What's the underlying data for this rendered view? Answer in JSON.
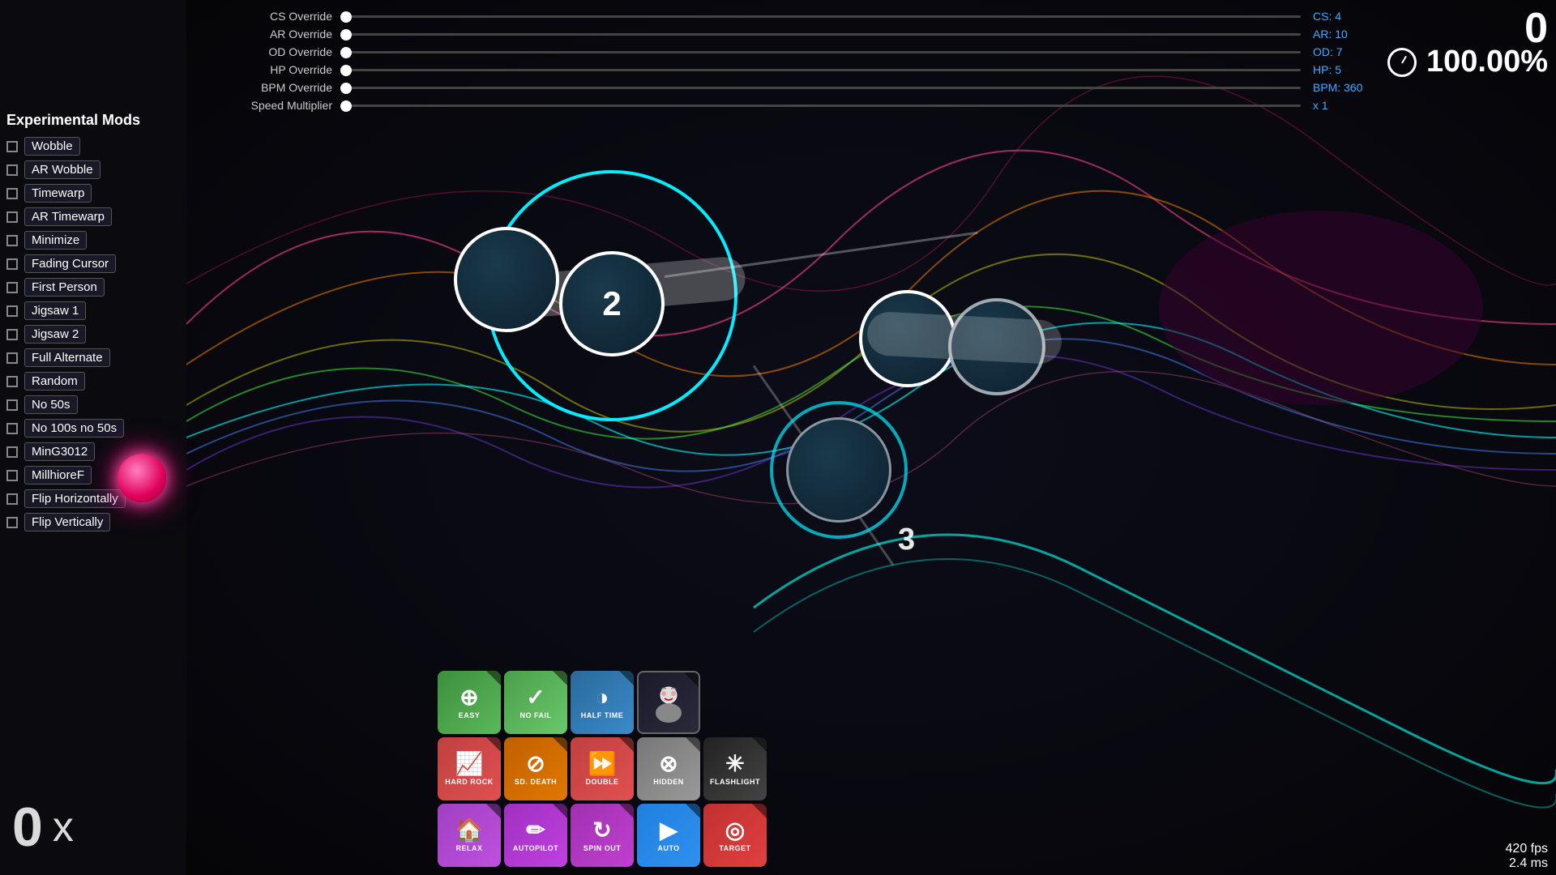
{
  "sliders": {
    "cs_override": {
      "label": "CS Override",
      "value": "CS: 4"
    },
    "ar_override": {
      "label": "AR Override",
      "value": "AR: 10"
    },
    "od_override": {
      "label": "OD Override",
      "value": "OD: 7"
    },
    "hp_override": {
      "label": "HP Override",
      "value": "HP: 5"
    },
    "bpm_override": {
      "label": "BPM Override",
      "value": "BPM: 360"
    },
    "speed_multiplier": {
      "label": "Speed Multiplier",
      "value": "x 1"
    }
  },
  "sidebar": {
    "title": "Experimental Mods",
    "mods": [
      {
        "label": "Wobble",
        "checked": false
      },
      {
        "label": "AR Wobble",
        "checked": false
      },
      {
        "label": "Timewarp",
        "checked": false
      },
      {
        "label": "AR Timewarp",
        "checked": false
      },
      {
        "label": "Minimize",
        "checked": false
      },
      {
        "label": "Fading Cursor",
        "checked": false
      },
      {
        "label": "First Person",
        "checked": false
      },
      {
        "label": "Jigsaw 1",
        "checked": false
      },
      {
        "label": "Jigsaw 2",
        "checked": false
      },
      {
        "label": "Full Alternate",
        "checked": false
      },
      {
        "label": "Random",
        "checked": false
      },
      {
        "label": "No 50s",
        "checked": false
      },
      {
        "label": "No 100s no 50s",
        "checked": false
      },
      {
        "label": "MinG3012",
        "checked": false
      },
      {
        "label": "MillhioreF",
        "checked": false
      },
      {
        "label": "Flip Horizontally",
        "checked": false
      },
      {
        "label": "Flip Vertically",
        "checked": false
      }
    ]
  },
  "score": {
    "main": "0",
    "accuracy": "100.00%"
  },
  "bottom_score": {
    "number": "0",
    "multiplier": "x"
  },
  "fps": "420 fps",
  "ms": "2.4 ms",
  "mod_buttons": [
    {
      "id": "easy",
      "label": "EASY",
      "icon": "⊕",
      "class": "btn-easy"
    },
    {
      "id": "nofail",
      "label": "NO FAIL",
      "icon": "✓",
      "class": "btn-nofail"
    },
    {
      "id": "halftime",
      "label": "HALF TIME",
      "icon": "◑",
      "class": "btn-halftime"
    },
    {
      "id": "hardrock",
      "label": "HARD ROCK",
      "icon": "📈",
      "class": "btn-hardrock"
    },
    {
      "id": "sddeath",
      "label": "SD. DEATH",
      "icon": "⊘",
      "class": "btn-sddeath"
    },
    {
      "id": "double",
      "label": "DOUBLE",
      "icon": "⏩",
      "class": "btn-double"
    },
    {
      "id": "hidden",
      "label": "HIDDEN",
      "icon": "⊗",
      "class": "btn-hidden"
    },
    {
      "id": "flashlight",
      "label": "FLASHLIGHT",
      "icon": "✳",
      "class": "btn-flashlight"
    },
    {
      "id": "relax",
      "label": "RELAX",
      "icon": "🏠",
      "class": "btn-relax"
    },
    {
      "id": "autopilot",
      "label": "AUTOPILOT",
      "icon": "✏",
      "class": "btn-autopilot"
    },
    {
      "id": "spinout",
      "label": "SPIN OUT",
      "icon": "↻",
      "class": "btn-spinout"
    },
    {
      "id": "auto",
      "label": "AUTO",
      "icon": "▶",
      "class": "btn-auto"
    },
    {
      "id": "target",
      "label": "TARGET",
      "icon": "◎",
      "class": "btn-target"
    }
  ]
}
